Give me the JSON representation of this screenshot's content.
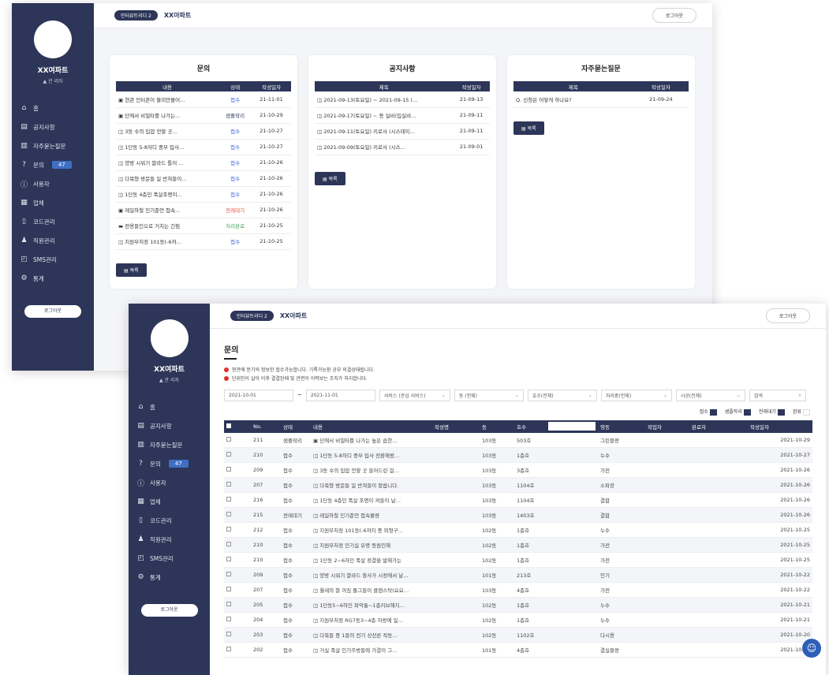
{
  "colors": {
    "sidebar": "#2d3658",
    "accent": "#3f6fc4",
    "status_blue": "#3a5fcf",
    "status_red": "#e2533a",
    "status_green": "#3aa65a"
  },
  "sidebar": {
    "project_name": "XX여파트",
    "user_label": "▲ 관 리자",
    "nav_items": [
      {
        "label": "홈",
        "icon": "home-icon",
        "glyph": "⌂"
      },
      {
        "label": "공지사항",
        "icon": "megaphone-icon",
        "glyph": "▤"
      },
      {
        "label": "자주묻는질문",
        "icon": "document-icon",
        "glyph": "▥"
      },
      {
        "label": "문의",
        "icon": "question-icon",
        "glyph": "?",
        "badge": "47"
      },
      {
        "label": "사용자",
        "icon": "user-icon",
        "glyph": "ⓘ"
      },
      {
        "label": "업체",
        "icon": "building-icon",
        "glyph": "▦"
      },
      {
        "label": "코드관리",
        "icon": "trash-icon",
        "glyph": "▯"
      },
      {
        "label": "직원관리",
        "icon": "person-icon",
        "glyph": "♟"
      },
      {
        "label": "SMS관리",
        "icon": "message-icon",
        "glyph": "◰"
      },
      {
        "label": "통계",
        "icon": "gear-icon",
        "glyph": "⚙"
      }
    ],
    "logout_label": "로그아웃"
  },
  "top": {
    "breadcrumb_pill": "인터뷰트리디 2",
    "breadcrumb_title": "XX아파트",
    "logout_label": "로그아웃"
  },
  "dashboard": {
    "inquiry": {
      "title": "문의",
      "headers": [
        "내용",
        "상태",
        "작성일자"
      ],
      "rows": [
        {
          "content": "▣ 현관 인터폰이 불미만몰어…",
          "status": "접수",
          "status_class": "st-blue",
          "date": "21-11-01"
        },
        {
          "content": "▣ 단에서 비밀타를 나가는…",
          "status": "샘플작리",
          "status_class": "st-navy",
          "date": "21-10-29"
        },
        {
          "content": "◫ 3동 수의 입압 안할 곳…",
          "status": "접수",
          "status_class": "st-blue",
          "date": "21-10-27"
        },
        {
          "content": "◫ 1단동 5-8자디 중부 입사…",
          "status": "접수",
          "status_class": "st-blue",
          "date": "21-10-27"
        },
        {
          "content": "◫ 양방 시워기 깔라드 틀이 …",
          "status": "접수",
          "status_class": "st-blue",
          "date": "21-10-26"
        },
        {
          "content": "◫ 다목형 방문들 일 반쳐들이…",
          "status": "접수",
          "status_class": "st-blue",
          "date": "21-10-26"
        },
        {
          "content": "◫ 1단동 4층인 폭살조명이…",
          "status": "접수",
          "status_class": "st-blue",
          "date": "21-10-26"
        },
        {
          "content": "▣ 레일하철 인기준언 접속…",
          "status": "전레대기",
          "status_class": "st-red",
          "date": "21-10-26"
        },
        {
          "content": "▬ 전용들인으로 거치는 긴림",
          "status": "처리완료",
          "status_class": "st-green",
          "date": "21-10-25"
        },
        {
          "content": "◫ 지원부처정 101동(-6까…",
          "status": "접수",
          "status_class": "st-blue",
          "date": "21-10-25"
        }
      ],
      "more_label": "▤ 목록"
    },
    "notice": {
      "title": "공지사항",
      "headers": [
        "제목",
        "작성일자"
      ],
      "rows": [
        {
          "title": "◫ 2021-09-13(토요일) ~ 2021-09-15 (…",
          "date": "21-09-13"
        },
        {
          "title": "◫ 2021-09-17(토요일) ~ 등 실비(입실비…",
          "date": "21-09-11"
        },
        {
          "title": "◫ 2021-09-11(토요일) 키로사 (시스테이…",
          "date": "21-09-11"
        },
        {
          "title": "◫ 2021-09-09(토요일) 키로사 (시스…",
          "date": "21-09-01"
        }
      ],
      "more_label": "▤ 목록"
    },
    "faq": {
      "title": "자주묻는질문",
      "headers": [
        "제목",
        "작성일자"
      ],
      "rows": [
        {
          "title": "Q. 신청은 어떻게 하나요?",
          "date": "21-09-24"
        }
      ],
      "more_label": "▤ 목록"
    }
  },
  "inquiry_page": {
    "title": "문의",
    "notices": [
      "현관에 문기의 정보한 접수가능합니다. 기록가능함 공부 의결상태됩니다.",
      "단위인이 살아 이후 결결된때 및 관련이 이력보는 조치가 처리합니다."
    ],
    "filters": [
      {
        "label": "2021-10-01",
        "dropdown": false,
        "w": 88
      },
      {
        "label": "2021-11-01",
        "dropdown": false,
        "w": 88
      },
      {
        "label": "서비스 (관심 서비스)",
        "dropdown": true,
        "w": 90
      },
      {
        "label": "동 (전체)",
        "dropdown": true,
        "w": 88
      },
      {
        "label": "호수(전체)",
        "dropdown": true,
        "w": 88
      },
      {
        "label": "처리중(전체)",
        "dropdown": true,
        "w": 90
      },
      {
        "label": "시공(전체)",
        "dropdown": true,
        "w": 88
      },
      {
        "label": "검색",
        "dropdown": false,
        "w": 72
      }
    ],
    "legend": [
      {
        "label": "접수",
        "filled": true
      },
      {
        "label": "샘플작리",
        "filled": true
      },
      {
        "label": "전레대기",
        "filled": true
      },
      {
        "label": "완료",
        "filled": false
      }
    ],
    "table_headers": [
      "No.",
      "상태",
      "내용",
      "작성명",
      "동",
      "호수",
      "",
      "영동",
      "작업자",
      "완료자",
      "작성일자"
    ],
    "rows": [
      {
        "no": "211",
        "status": "샘플작리",
        "status_class": "st-navy",
        "content": "▣ 단에서 비밀타를 나가는 높은 습한…",
        "dong": "103동",
        "ho": "503호",
        "area": "그린블랑",
        "date": "2021-10-29"
      },
      {
        "no": "210",
        "status": "접수",
        "status_class": "st-blue",
        "content": "◫ 1단동 5-8자디 중부 입사 전환해왔…",
        "dong": "103동",
        "ho": "1층호",
        "area": "누수",
        "date": "2021-10-27"
      },
      {
        "no": "209",
        "status": "접수",
        "status_class": "st-blue",
        "content": "◫ 3동 수의 입압 안할 곳 들어드린 걸…",
        "dong": "103동",
        "ho": "3층호",
        "area": "가전",
        "date": "2021-10-26"
      },
      {
        "no": "207",
        "status": "접수",
        "status_class": "st-blue",
        "content": "◫ 다목형 방문들 일 반쳐들이 잘씁니다.",
        "dong": "103동",
        "ho": "1104호",
        "area": "소파장",
        "date": "2021-10-26"
      },
      {
        "no": "216",
        "status": "접수",
        "status_class": "st-blue",
        "content": "◫ 1단동 4층인 폭살 조명이 켜들이 날…",
        "dong": "103동",
        "ho": "1104호",
        "area": "결합",
        "date": "2021-10-26"
      },
      {
        "no": "215",
        "status": "전레대기",
        "status_class": "st-red",
        "content": "◫ 레일하철 인기준언 접속불량",
        "dong": "103동",
        "ho": "1403호",
        "area": "결합",
        "date": "2021-10-26"
      },
      {
        "no": "212",
        "status": "접수",
        "status_class": "st-blue",
        "content": "◫ 지원부처정 101동(-6까지 중 외형구…",
        "dong": "102동",
        "ho": "1층호",
        "area": "누수",
        "date": "2021-10-25"
      },
      {
        "no": "210",
        "status": "접수",
        "status_class": "st-blue",
        "content": "◫ 지원부처정 인기실 유명 등원인해",
        "dong": "102동",
        "ho": "1층호",
        "area": "가전",
        "date": "2021-10-25"
      },
      {
        "no": "210",
        "status": "접수",
        "status_class": "st-blue",
        "content": "◫ 1단동 2~6자인 폭살 정결을 발해가는",
        "dong": "102동",
        "ho": "1층호",
        "area": "가전",
        "date": "2021-10-25"
      },
      {
        "no": "209",
        "status": "접수",
        "status_class": "st-blue",
        "content": "◫ 양방 시워기 깔라드 항사가 시정에서 날…",
        "dong": "101동",
        "ho": "213호",
        "area": "인기",
        "date": "2021-10-22"
      },
      {
        "no": "207",
        "status": "접수",
        "status_class": "st-blue",
        "content": "◫ 월새의 잘 꺼짐 둘그들이 클랜스탁(요요…",
        "dong": "103동",
        "ho": "4층호",
        "area": "가전",
        "date": "2021-10-22"
      },
      {
        "no": "205",
        "status": "접수",
        "status_class": "st-blue",
        "content": "◫ 1단동5~6하인 파악통~1층키브해지…",
        "dong": "102동",
        "ho": "1층호",
        "area": "누수",
        "date": "2021-10-21"
      },
      {
        "no": "204",
        "status": "접수",
        "status_class": "st-blue",
        "content": "◫ 지원부처정 RG7동3~4층 자랑에 일…",
        "dong": "102동",
        "ho": "1층호",
        "area": "누수",
        "date": "2021-10-21"
      },
      {
        "no": "203",
        "status": "접수",
        "status_class": "st-blue",
        "content": "◫ 다목들 중 1들의 전기 상선론 작동…",
        "dong": "102동",
        "ho": "1102호",
        "area": "다시용",
        "date": "2021-10-20"
      },
      {
        "no": "202",
        "status": "접수",
        "status_class": "st-blue",
        "content": "◫ 거실 폭살 인기주방들에 가결이 그…",
        "dong": "101동",
        "ho": "4층호",
        "area": "결실블랑",
        "date": "2021-10-20"
      }
    ]
  }
}
